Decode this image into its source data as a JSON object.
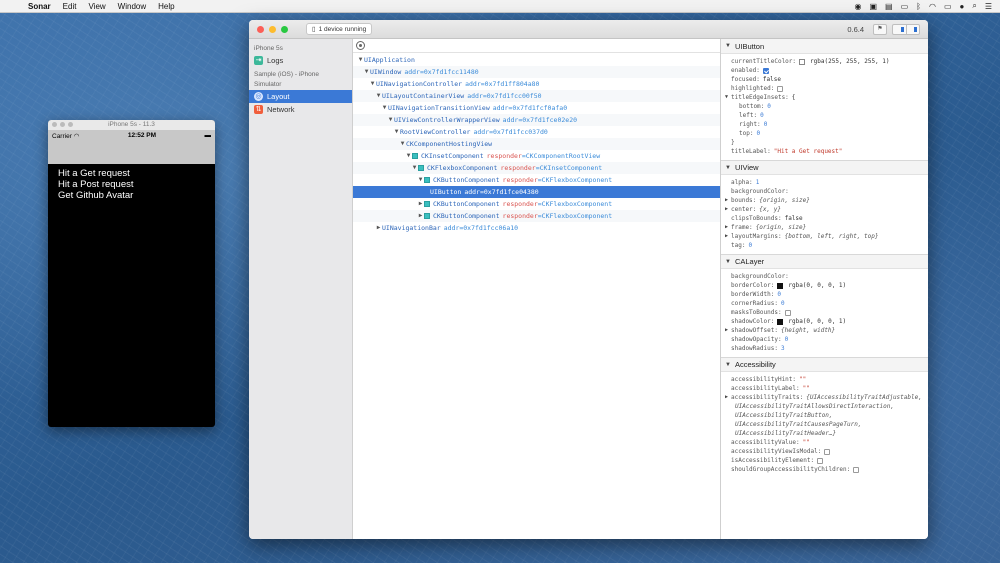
{
  "menubar": {
    "app": "Sonar",
    "items": [
      "Edit",
      "View",
      "Window",
      "Help"
    ]
  },
  "simulator": {
    "title": "iPhone 5s - 11.3",
    "carrier": "Carrier",
    "time": "12:52 PM",
    "links": [
      "Hit a Get request",
      "Hit a Post request",
      "Get Github Avatar"
    ]
  },
  "window": {
    "device_button": "1 device running",
    "version": "0.6.4"
  },
  "sidebar": {
    "section1": "iPhone 5s",
    "logs": "Logs",
    "section2": "Sample (iOS) - iPhone Simulator",
    "layout": "Layout",
    "network": "Network"
  },
  "tree": {
    "rows": [
      {
        "name": "UIApplication",
        "attr": "",
        "val": ""
      },
      {
        "name": "UIWindow",
        "attr": "",
        "val": "addr=0x7fd1fcc11480"
      },
      {
        "name": "UINavigationController",
        "attr": "",
        "val": "addr=0x7fd1ff804a80"
      },
      {
        "name": "UILayoutContainerView",
        "attr": "",
        "val": "addr=0x7fd1fcc00f50"
      },
      {
        "name": "UINavigationTransitionView",
        "attr": "",
        "val": "addr=0x7fd1fcf0afa0"
      },
      {
        "name": "UIViewControllerWrapperView",
        "attr": "",
        "val": "addr=0x7fd1fce02e20"
      },
      {
        "name": "RootViewController",
        "attr": "",
        "val": "addr=0x7fd1fcc037d0"
      },
      {
        "name": "CKComponentHostingView",
        "attr": "",
        "val": ""
      },
      {
        "name": "CKInsetComponent",
        "attr": "responder",
        "val": "=CKComponentRootView"
      },
      {
        "name": "CKFlexboxComponent",
        "attr": "responder",
        "val": "=CKInsetComponent"
      },
      {
        "name": "CKButtonComponent",
        "attr": "responder",
        "val": "=CKFlexboxComponent"
      },
      {
        "name": "UIButton",
        "attr": "",
        "val": "addr=0x7fd1fce04380"
      },
      {
        "name": "CKButtonComponent",
        "attr": "responder",
        "val": "=CKFlexboxComponent"
      },
      {
        "name": "CKButtonComponent",
        "attr": "responder",
        "val": "=CKFlexboxComponent"
      },
      {
        "name": "UINavigationBar",
        "attr": "",
        "val": "addr=0x7fd1fcc06a10"
      }
    ]
  },
  "inspector": {
    "uibutton": {
      "title": "UIButton",
      "currentTitleColor_key": "currentTitleColor:",
      "currentTitleColor_val": "rgba(255, 255, 255, 1)",
      "enabled_key": "enabled:",
      "focused_key": "focused:",
      "focused_val": "false",
      "highlighted_key": "highlighted:",
      "titleEdgeInsets_key": "titleEdgeInsets:",
      "titleEdgeInsets_open": "{",
      "bottom_key": "bottom:",
      "bottom_val": "0",
      "left_key": "left:",
      "left_val": "0",
      "right_key": "right:",
      "right_val": "0",
      "top_key": "top:",
      "top_val": "0",
      "close": "}",
      "titleLabel_key": "titleLabel:",
      "titleLabel_val": "\"Hit a Get request\""
    },
    "uiview": {
      "title": "UIView",
      "alpha_key": "alpha:",
      "alpha_val": "1",
      "bg_key": "backgroundColor:",
      "bounds_key": "bounds:",
      "bounds_val": "{origin, size}",
      "center_key": "center:",
      "center_val": "{x, y}",
      "clips_key": "clipsToBounds:",
      "clips_val": "false",
      "frame_key": "frame:",
      "frame_val": "{origin, size}",
      "margins_key": "layoutMargins:",
      "margins_val": "{bottom, left, right, top}",
      "tag_key": "tag:",
      "tag_val": "0"
    },
    "calayer": {
      "title": "CALayer",
      "bg_key": "backgroundColor:",
      "borderColor_key": "borderColor:",
      "borderColor_val": "rgba(0, 0, 0, 1)",
      "borderWidth_key": "borderWidth:",
      "borderWidth_val": "0",
      "cornerRadius_key": "cornerRadius:",
      "cornerRadius_val": "0",
      "masks_key": "masksToBounds:",
      "shadowColor_key": "shadowColor:",
      "shadowColor_val": "rgba(0, 0, 0, 1)",
      "shadowOffset_key": "shadowOffset:",
      "shadowOffset_val": "{height, width}",
      "shadowOpacity_key": "shadowOpacity:",
      "shadowOpacity_val": "0",
      "shadowRadius_key": "shadowRadius:",
      "shadowRadius_val": "3"
    },
    "accessibility": {
      "title": "Accessibility",
      "hint_key": "accessibilityHint:",
      "hint_val": "\"\"",
      "label_key": "accessibilityLabel:",
      "label_val": "\"\"",
      "traits_key": "accessibilityTraits:",
      "traits_val1": "{UIAccessibilityTraitAdjustable,",
      "traits_val2": "UIAccessibilityTraitAllowsDirectInteraction,",
      "traits_val3": "UIAccessibilityTraitButton,",
      "traits_val4": "UIAccessibilityTraitCausesPageTurn,",
      "traits_val5": "UIAccessibilityTraitHeader…}",
      "value_key": "accessibilityValue:",
      "value_val": "\"\"",
      "modal_key": "accessibilityViewIsModal:",
      "isElement_key": "isAccessibilityElement:",
      "group_key": "shouldGroupAccessibilityChildren:"
    }
  },
  "colors": {
    "accent": "#3b79d6",
    "desktop": "#2f5f93"
  }
}
